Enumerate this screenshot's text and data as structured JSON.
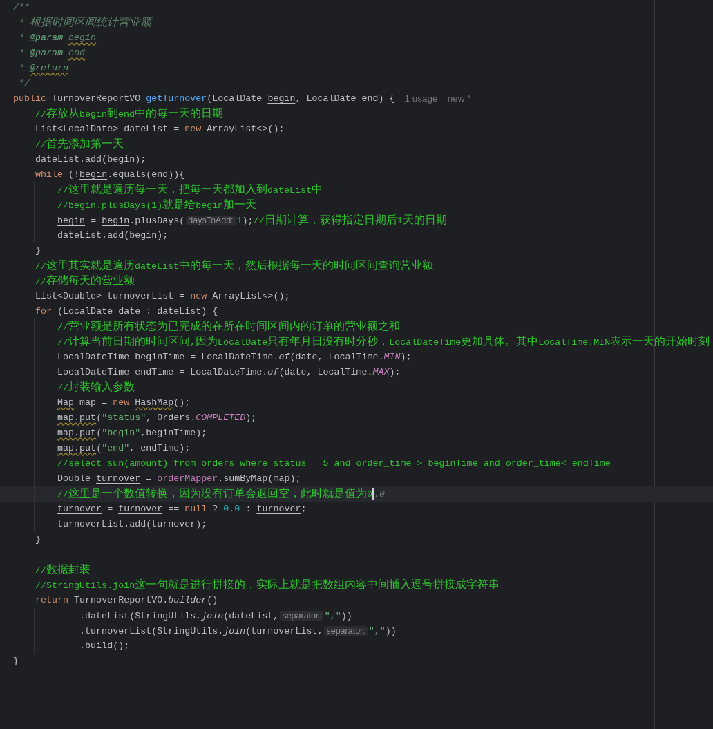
{
  "editor": {
    "lines": [
      {
        "kind": "code",
        "tokens": [
          {
            "kind": "doc",
            "text": "/**"
          }
        ]
      },
      {
        "kind": "code",
        "tokens": [
          {
            "kind": "doc",
            "text": " * 根据时间区间统计营业额"
          }
        ]
      },
      {
        "kind": "code",
        "tokens": [
          {
            "kind": "doc",
            "text": " * "
          },
          {
            "kind": "doctag",
            "text": "@param"
          },
          {
            "kind": "docwarn",
            "text": " begin"
          }
        ]
      },
      {
        "kind": "code",
        "tokens": [
          {
            "kind": "doc",
            "text": " * "
          },
          {
            "kind": "doctag",
            "text": "@param"
          },
          {
            "kind": "docwarn",
            "text": " end"
          }
        ]
      },
      {
        "kind": "code",
        "tokens": [
          {
            "kind": "doc",
            "text": " * "
          },
          {
            "kind": "doctagwarn",
            "text": "@return"
          }
        ]
      },
      {
        "kind": "code",
        "tokens": [
          {
            "kind": "doc",
            "text": " */"
          }
        ]
      },
      {
        "kind": "code",
        "tokens": [
          {
            "kind": "keyword",
            "text": "public"
          },
          {
            "kind": "plain",
            "text": " TurnoverReportVO "
          },
          {
            "kind": "method",
            "text": "getTurnover"
          },
          {
            "kind": "plain",
            "text": "(LocalDate "
          },
          {
            "kind": "var",
            "text": "begin"
          },
          {
            "kind": "plain",
            "text": ", LocalDate end) {"
          }
        ],
        "annotations": [
          "1 usage",
          "new *"
        ]
      },
      {
        "kind": "code",
        "tokens": [
          {
            "kind": "comment",
            "text": "    //存放从begin到end中的每一天的日期"
          }
        ]
      },
      {
        "kind": "code",
        "tokens": [
          {
            "kind": "plain",
            "text": "    List<LocalDate> dateList = "
          },
          {
            "kind": "keyword",
            "text": "new"
          },
          {
            "kind": "plain",
            "text": " ArrayList<>();"
          }
        ]
      },
      {
        "kind": "code",
        "tokens": [
          {
            "kind": "comment",
            "text": "    //首先添加第一天"
          }
        ]
      },
      {
        "kind": "code",
        "tokens": [
          {
            "kind": "plain",
            "text": "    dateList.add("
          },
          {
            "kind": "var",
            "text": "begin"
          },
          {
            "kind": "plain",
            "text": ");"
          }
        ]
      },
      {
        "kind": "code",
        "tokens": [
          {
            "kind": "keyword",
            "text": "    while"
          },
          {
            "kind": "plain",
            "text": " (!"
          },
          {
            "kind": "var",
            "text": "begin"
          },
          {
            "kind": "plain",
            "text": ".equals(end)){"
          }
        ]
      },
      {
        "kind": "code",
        "tokens": [
          {
            "kind": "comment",
            "text": "        //这里就是遍历每一天，把每一天都加入到dateList中"
          }
        ]
      },
      {
        "kind": "code",
        "tokens": [
          {
            "kind": "comment",
            "text": "        //begin.plusDays(1)就是给begin加一天"
          }
        ]
      },
      {
        "kind": "code",
        "tokens": [
          {
            "kind": "var",
            "text": "        begin"
          },
          {
            "kind": "plain",
            "text": " = "
          },
          {
            "kind": "var",
            "text": "begin"
          },
          {
            "kind": "plain",
            "text": ".plusDays("
          },
          {
            "kind": "hint",
            "text": "daysToAdd:"
          },
          {
            "kind": "number",
            "text": "1"
          },
          {
            "kind": "plain",
            "text": ");"
          },
          {
            "kind": "comment",
            "text": "//日期计算，获得指定日期后1天的日期"
          }
        ]
      },
      {
        "kind": "code",
        "tokens": [
          {
            "kind": "plain",
            "text": "        dateList.add("
          },
          {
            "kind": "var",
            "text": "begin"
          },
          {
            "kind": "plain",
            "text": ");"
          }
        ]
      },
      {
        "kind": "code",
        "tokens": [
          {
            "kind": "plain",
            "text": "    }"
          }
        ]
      },
      {
        "kind": "code",
        "tokens": [
          {
            "kind": "comment",
            "text": "    //这里其实就是遍历dateList中的每一天，然后根据每一天的时间区间查询营业额"
          }
        ]
      },
      {
        "kind": "code",
        "tokens": [
          {
            "kind": "comment",
            "text": "    //存储每天的营业额"
          }
        ]
      },
      {
        "kind": "code",
        "tokens": [
          {
            "kind": "plain",
            "text": "    List<Double> turnoverList = "
          },
          {
            "kind": "keyword",
            "text": "new"
          },
          {
            "kind": "plain",
            "text": " ArrayList<>();"
          }
        ]
      },
      {
        "kind": "code",
        "tokens": [
          {
            "kind": "keyword",
            "text": "    for"
          },
          {
            "kind": "plain",
            "text": " (LocalDate date : dateList) {"
          }
        ]
      },
      {
        "kind": "code",
        "tokens": [
          {
            "kind": "comment",
            "text": "        //营业额是所有状态为已完成的在所在时间区间内的订单的营业额之和"
          }
        ]
      },
      {
        "kind": "code",
        "tokens": [
          {
            "kind": "comment",
            "text": "        //计算当前日期的时间区间,因为LocalDate只有年月日没有时分秒，LocalDateTime更加具体。其中LocalTime.MIN表示一天的开始时刻"
          }
        ]
      },
      {
        "kind": "code",
        "tokens": [
          {
            "kind": "plain",
            "text": "        LocalDateTime beginTime = LocalDateTime."
          },
          {
            "kind": "static",
            "text": "of"
          },
          {
            "kind": "plain",
            "text": "(date, LocalTime."
          },
          {
            "kind": "constant",
            "text": "MIN"
          },
          {
            "kind": "plain",
            "text": ");"
          }
        ]
      },
      {
        "kind": "code",
        "tokens": [
          {
            "kind": "plain",
            "text": "        LocalDateTime endTime = LocalDateTime."
          },
          {
            "kind": "static",
            "text": "of"
          },
          {
            "kind": "plain",
            "text": "(date, LocalTime."
          },
          {
            "kind": "constant",
            "text": "MAX"
          },
          {
            "kind": "plain",
            "text": ");"
          }
        ]
      },
      {
        "kind": "code",
        "tokens": [
          {
            "kind": "comment",
            "text": "        //封装输入参数"
          }
        ]
      },
      {
        "kind": "code",
        "tokens": [
          {
            "kind": "warn",
            "text": "        Map"
          },
          {
            "kind": "plain",
            "text": " map = "
          },
          {
            "kind": "keyword",
            "text": "new "
          },
          {
            "kind": "warn",
            "text": "HashMap"
          },
          {
            "kind": "plain",
            "text": "();"
          }
        ]
      },
      {
        "kind": "code",
        "tokens": [
          {
            "kind": "warn",
            "text": "        map.put"
          },
          {
            "kind": "plain",
            "text": "("
          },
          {
            "kind": "string",
            "text": "\"status\""
          },
          {
            "kind": "plain",
            "text": ", Orders."
          },
          {
            "kind": "constant",
            "text": "COMPLETED"
          },
          {
            "kind": "plain",
            "text": ");"
          }
        ]
      },
      {
        "kind": "code",
        "tokens": [
          {
            "kind": "warn",
            "text": "        map.put"
          },
          {
            "kind": "plain",
            "text": "("
          },
          {
            "kind": "string",
            "text": "\"begin\""
          },
          {
            "kind": "plain",
            "text": ",beginTime);"
          }
        ]
      },
      {
        "kind": "code",
        "tokens": [
          {
            "kind": "warn",
            "text": "        map.put"
          },
          {
            "kind": "plain",
            "text": "("
          },
          {
            "kind": "string",
            "text": "\"end\""
          },
          {
            "kind": "plain",
            "text": ", endTime);"
          }
        ]
      },
      {
        "kind": "code",
        "tokens": [
          {
            "kind": "comment",
            "text": "        //select sun(amount) from orders where status = 5 and order_time > beginTime and order_time< endTime"
          }
        ]
      },
      {
        "kind": "code",
        "tokens": [
          {
            "kind": "plain",
            "text": "        Double "
          },
          {
            "kind": "var",
            "text": "turnover"
          },
          {
            "kind": "plain",
            "text": " = "
          },
          {
            "kind": "field",
            "text": "orderMapper"
          },
          {
            "kind": "plain",
            "text": ".sumByMap(map);"
          }
        ]
      },
      {
        "kind": "code",
        "current": true,
        "tokens": [
          {
            "kind": "comment",
            "text": "        //这里是一个数值转换，因为没有订单会返回空，此时就是值为0"
          },
          {
            "kind": "caret"
          },
          {
            "kind": "ghost",
            "text": ".0"
          }
        ]
      },
      {
        "kind": "code",
        "tokens": [
          {
            "kind": "var",
            "text": "        turnover"
          },
          {
            "kind": "plain",
            "text": " = "
          },
          {
            "kind": "var",
            "text": "turnover"
          },
          {
            "kind": "plain",
            "text": " == "
          },
          {
            "kind": "keyword",
            "text": "null"
          },
          {
            "kind": "plain",
            "text": " ? "
          },
          {
            "kind": "number",
            "text": "0.0"
          },
          {
            "kind": "plain",
            "text": " : "
          },
          {
            "kind": "var",
            "text": "turnover"
          },
          {
            "kind": "plain",
            "text": ";"
          }
        ]
      },
      {
        "kind": "code",
        "tokens": [
          {
            "kind": "plain",
            "text": "        turnoverList.add("
          },
          {
            "kind": "var",
            "text": "turnover"
          },
          {
            "kind": "plain",
            "text": ");"
          }
        ]
      },
      {
        "kind": "code",
        "tokens": [
          {
            "kind": "plain",
            "text": "    }"
          }
        ]
      },
      {
        "kind": "blank"
      },
      {
        "kind": "code",
        "tokens": [
          {
            "kind": "comment",
            "text": "    //数据封装"
          }
        ]
      },
      {
        "kind": "code",
        "tokens": [
          {
            "kind": "comment",
            "text": "    //StringUtils.join这一句就是进行拼接的，实际上就是把数组内容中间插入逗号拼接成字符串"
          }
        ]
      },
      {
        "kind": "code",
        "tokens": [
          {
            "kind": "keyword",
            "text": "    return"
          },
          {
            "kind": "plain",
            "text": " TurnoverReportVO."
          },
          {
            "kind": "static",
            "text": "builder"
          },
          {
            "kind": "plain",
            "text": "()"
          }
        ]
      },
      {
        "kind": "code",
        "tokens": [
          {
            "kind": "plain",
            "text": "            .dateList(StringUtils."
          },
          {
            "kind": "static",
            "text": "join"
          },
          {
            "kind": "plain",
            "text": "(dateList,"
          },
          {
            "kind": "hint",
            "text": "separator:"
          },
          {
            "kind": "string",
            "text": "\",\""
          },
          {
            "kind": "plain",
            "text": "))"
          }
        ]
      },
      {
        "kind": "code",
        "tokens": [
          {
            "kind": "plain",
            "text": "            .turnoverList(StringUtils."
          },
          {
            "kind": "static",
            "text": "join"
          },
          {
            "kind": "plain",
            "text": "(turnoverList,"
          },
          {
            "kind": "hint",
            "text": "separator:"
          },
          {
            "kind": "string",
            "text": "\",\""
          },
          {
            "kind": "plain",
            "text": "))"
          }
        ]
      },
      {
        "kind": "code",
        "tokens": [
          {
            "kind": "plain",
            "text": "            .build();"
          }
        ]
      },
      {
        "kind": "code",
        "tokens": [
          {
            "kind": "plain",
            "text": "}"
          }
        ]
      }
    ]
  }
}
